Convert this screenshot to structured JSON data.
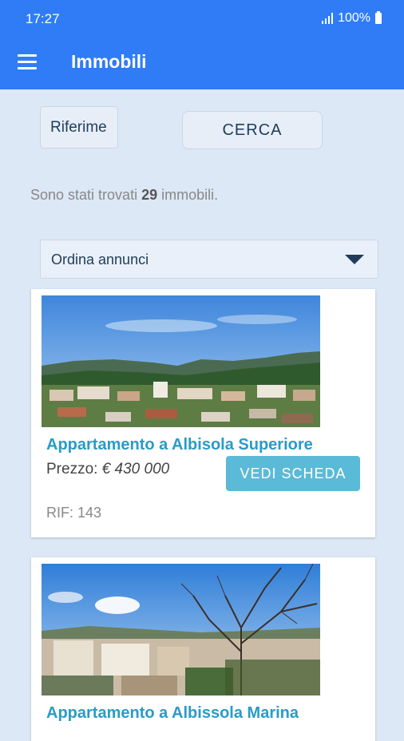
{
  "status_bar": {
    "time": "17:27",
    "battery": "100%"
  },
  "app_bar": {
    "title": "Immobili"
  },
  "search": {
    "ref_value": "Riferime",
    "button": "CERCA"
  },
  "results": {
    "prefix": "Sono stati trovati",
    "count": "29",
    "suffix": "immobili."
  },
  "sort": {
    "selected": "Ordina annunci"
  },
  "listings": [
    {
      "title": "Appartamento a Albisola Superiore",
      "price_label": "Prezzo:",
      "price_value": "€ 430 000",
      "button": "VEDI SCHEDA",
      "rif": "RIF: 143"
    },
    {
      "title": "Appartamento a Albissola Marina"
    }
  ],
  "colors": {
    "primary": "#2f7cf6",
    "accent": "#5bbad8",
    "title": "#2a9bc8",
    "background": "#dce8f6"
  }
}
